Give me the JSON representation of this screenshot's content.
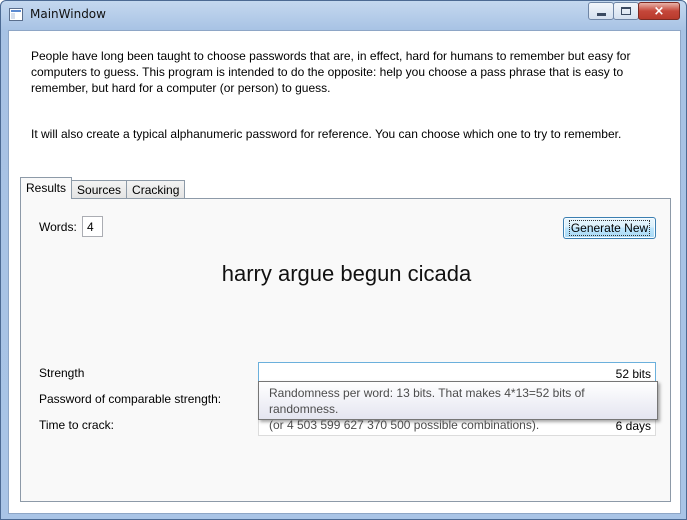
{
  "window": {
    "title": "MainWindow",
    "caption_buttons": {
      "minimize": "minimize-icon",
      "maximize": "maximize-icon",
      "close": "×"
    }
  },
  "intro": {
    "paragraph1": "People have long been taught to choose passwords that are, in effect, hard for humans to remember but easy for computers to guess. This program is intended to do the opposite: help you choose a pass phrase that is easy to remember, but hard for a computer (or person) to guess.",
    "paragraph2": "It will also create a typical alphanumeric password for reference. You can choose which one to try to remember."
  },
  "tabs": [
    {
      "label": "Results",
      "active": true
    },
    {
      "label": "Sources",
      "active": false
    },
    {
      "label": "Cracking",
      "active": false
    }
  ],
  "results": {
    "words_label": "Words:",
    "words_value": "4",
    "generate_label": "Generate New",
    "passphrase": "harry argue begun cicada",
    "strength_label": "Strength",
    "strength_value": "52 bits",
    "comparable_label": "Password of comparable strength:",
    "comparable_value": "",
    "time_label": "Time to crack:",
    "time_value": "6 days"
  },
  "tooltip": {
    "line1": "Randomness per word: 13 bits. That makes 4*13=52 bits of randomness.",
    "line2": "(or 4 503 599 627 370 500 possible combinations)."
  },
  "colors": {
    "title_bar": "#a9c4e6",
    "button_focus_border": "#3c7fb1",
    "close_button": "#c5473a"
  }
}
